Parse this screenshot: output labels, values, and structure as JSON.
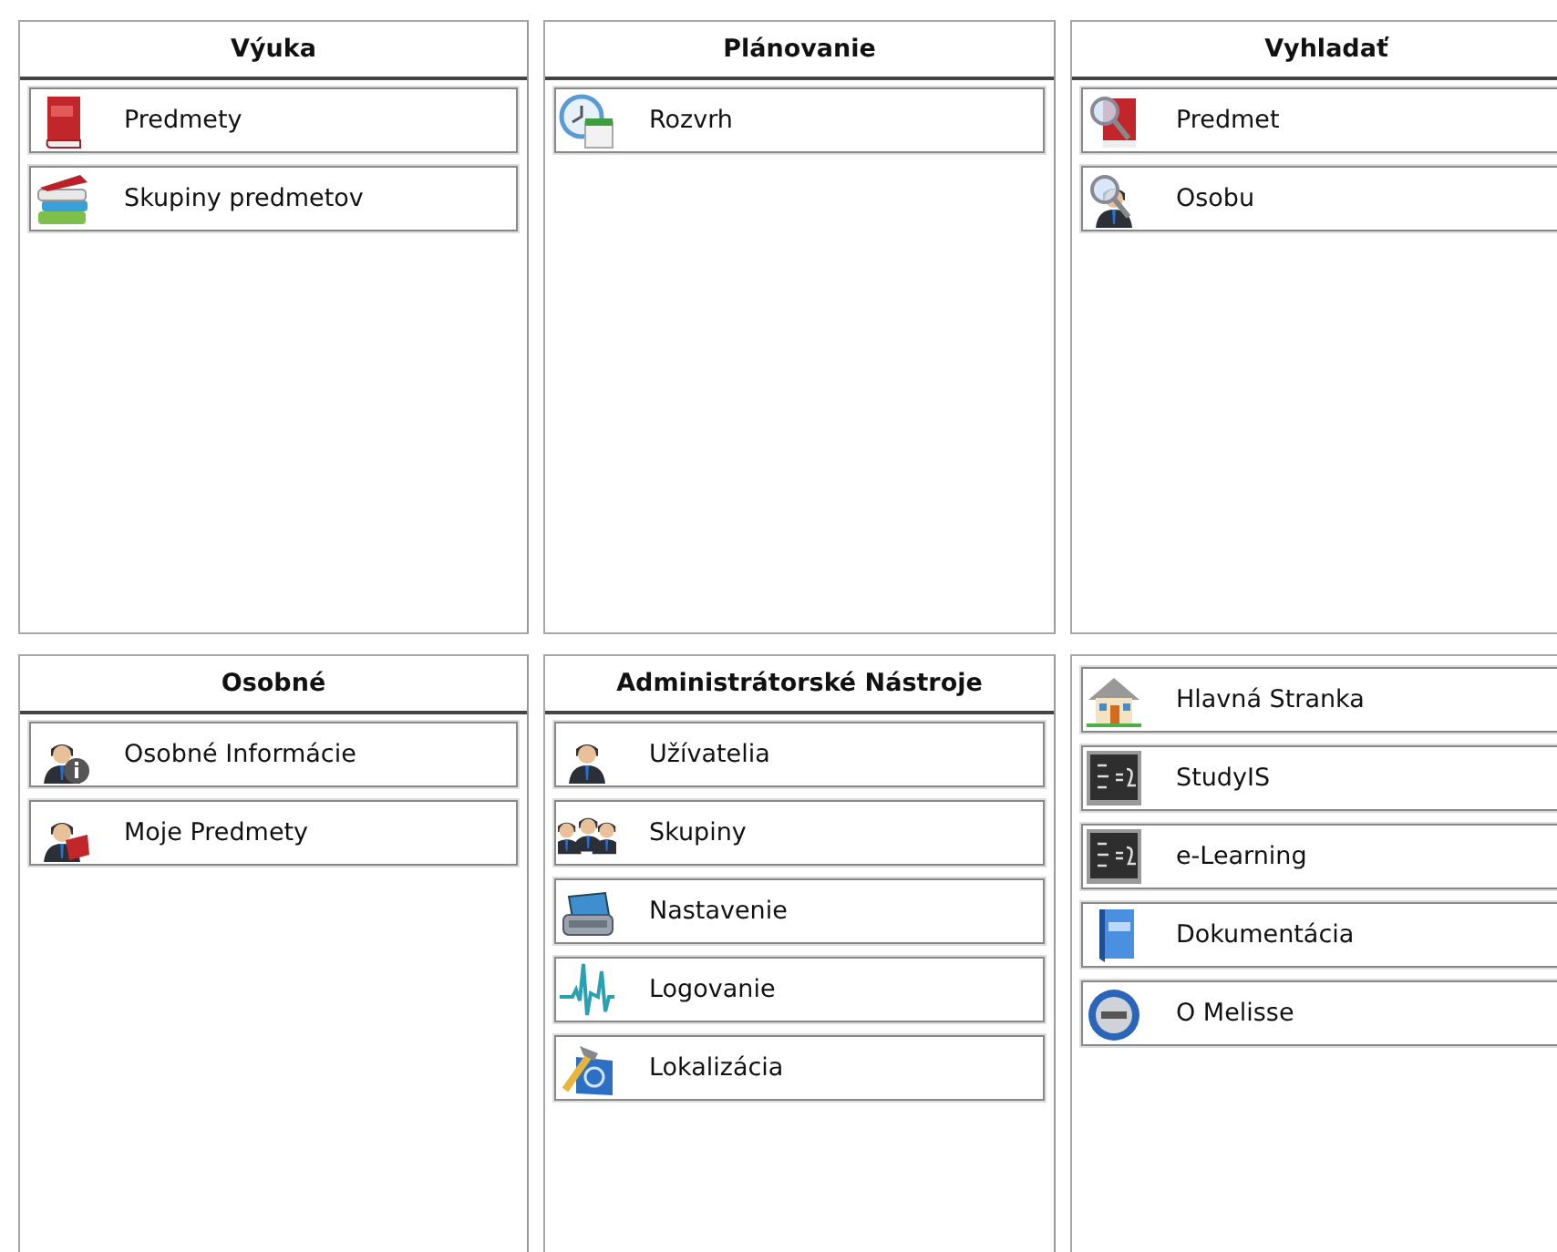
{
  "panels": [
    {
      "title": "Výuka",
      "items": [
        {
          "label": "Predmety"
        },
        {
          "label": "Skupiny predmetov"
        }
      ]
    },
    {
      "title": "Plánovanie",
      "items": [
        {
          "label": "Rozvrh"
        }
      ]
    },
    {
      "title": "Vyhladať",
      "items": [
        {
          "label": "Predmet"
        },
        {
          "label": "Osobu"
        }
      ]
    },
    {
      "title": "Osobné",
      "items": [
        {
          "label": "Osobné Informácie"
        },
        {
          "label": "Moje Predmety"
        }
      ]
    },
    {
      "title": "Administrátorské Nástroje",
      "items": [
        {
          "label": "Užívatelia"
        },
        {
          "label": "Skupiny"
        },
        {
          "label": "Nastavenie"
        },
        {
          "label": "Logovanie"
        },
        {
          "label": "Lokalizácia"
        }
      ]
    },
    {
      "items": [
        {
          "label": "Hlavná Stranka"
        },
        {
          "label": "StudyIS"
        },
        {
          "label": "e-Learning"
        },
        {
          "label": "Dokumentácia"
        },
        {
          "label": "O Melisse"
        }
      ]
    }
  ]
}
